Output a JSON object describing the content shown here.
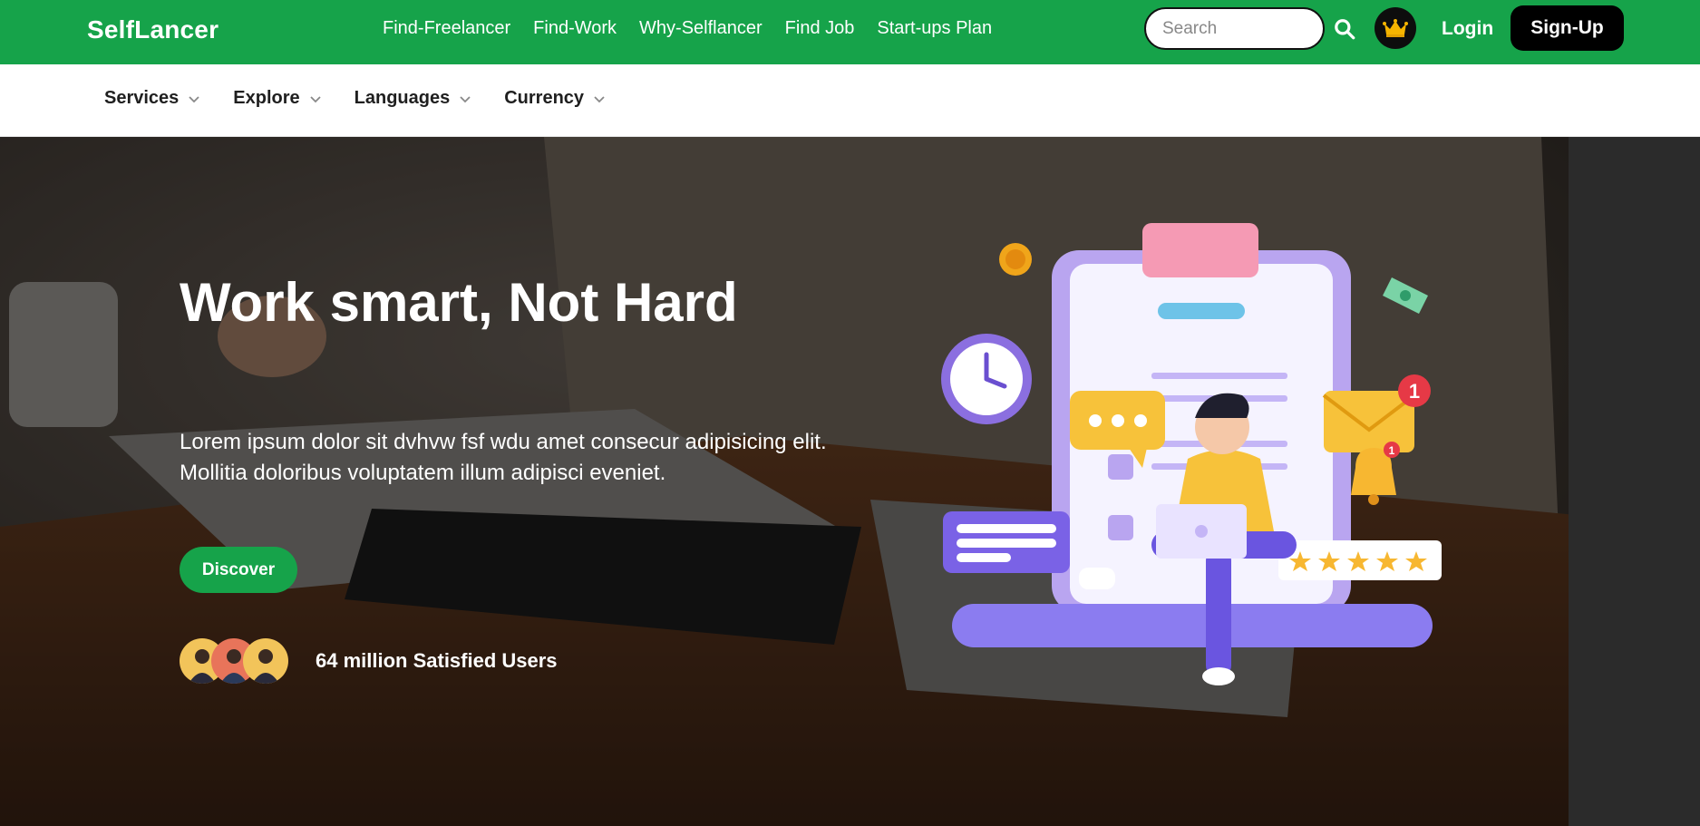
{
  "brand": {
    "name": "SelfLancer"
  },
  "nav": {
    "links": [
      "Find-Freelancer",
      "Find-Work",
      "Why-Selflancer",
      "Find Job",
      "Start-ups Plan"
    ],
    "search_placeholder": "Search",
    "login_label": "Login",
    "signup_label": "Sign-Up"
  },
  "subnav": {
    "items": [
      "Services",
      "Explore",
      "Languages",
      "Currency"
    ]
  },
  "hero": {
    "title": "Work smart, Not Hard",
    "description": "Lorem ipsum dolor sit dvhvw fsf wdu amet consecur adipisicing elit. Mollitia doloribus voluptatem illum adipisci eveniet.",
    "cta_label": "Discover",
    "users_text": "64 million Satisfied Users"
  },
  "illustration": {
    "notification_count": "1",
    "bell_count": "1",
    "rating_stars": 5
  },
  "colors": {
    "brand_green": "#16a34a",
    "dark": "#000000",
    "white": "#ffffff"
  },
  "icons": {
    "search": "search-icon",
    "crown": "crown-icon",
    "chevron": "chevron-down-icon"
  }
}
